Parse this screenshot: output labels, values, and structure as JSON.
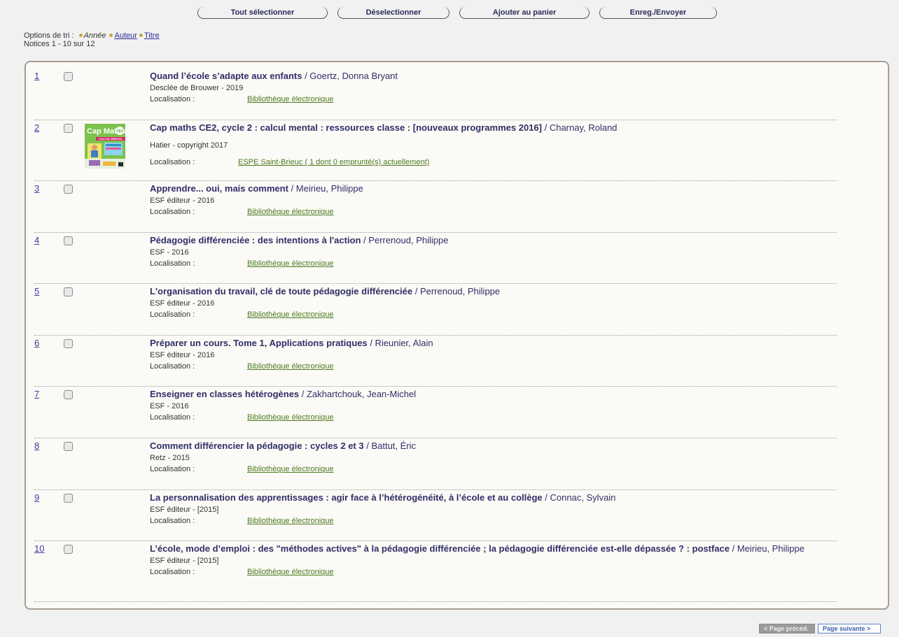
{
  "toolbar": {
    "select_all": "Tout sélectionner",
    "deselect": "Déselectionner",
    "add_cart": "Ajouter au panier",
    "save_send": "Enreg./Envoyer"
  },
  "sort": {
    "label": "Options de tri :",
    "year": "Année",
    "author": "Auteur",
    "title": "Titre",
    "count": "Notices 1 - 10 sur 12"
  },
  "records": [
    {
      "num": "1",
      "title": "Quand l’école s’adapte aux enfants",
      "author": " / Goertz, Donna Bryant",
      "pub": "Desclée de Brouwer - 2019",
      "loc_label": "Localisation :",
      "loc": "Bibliothèque électronique"
    },
    {
      "num": "2",
      "title": "Cap maths CE2, cycle 2 : calcul mental : ressources classe : [nouveaux programmes 2016]",
      "author": " / Charnay, Roland",
      "pub": "Hatier - copyright 2017",
      "loc_label": "Localisation :",
      "loc": "ESPE Saint-Brieuc ( 1 dont 0 emprunté(s) actuellement)",
      "cover": {
        "brand": "Cap Maths",
        "band": "CALCUL MENTAL",
        "level": "CE2"
      }
    },
    {
      "num": "3",
      "title": "Apprendre... oui, mais comment",
      "author": " / Meirieu, Philippe",
      "pub": "ESF éditeur - 2016",
      "loc_label": "Localisation :",
      "loc": "Bibliothèque électronique"
    },
    {
      "num": "4",
      "title": "Pédagogie différenciée : des intentions à l'action",
      "author": " / Perrenoud, Philippe",
      "pub": "ESF - 2016",
      "loc_label": "Localisation :",
      "loc": "Bibliothèque électronique"
    },
    {
      "num": "5",
      "title": "L'organisation du travail, clé de toute pédagogie différenciée",
      "author": " / Perrenoud, Philippe",
      "pub": "ESF éditeur - 2016",
      "loc_label": "Localisation :",
      "loc": "Bibliothèque électronique"
    },
    {
      "num": "6",
      "title": "Préparer un cours. Tome 1, Applications pratiques",
      "author": " / Rieunier, Alain",
      "pub": "ESF éditeur - 2016",
      "loc_label": "Localisation :",
      "loc": "Bibliothèque électronique"
    },
    {
      "num": "7",
      "title": "Enseigner en classes hétérogènes",
      "author": " / Zakhartchouk, Jean-Michel",
      "pub": "ESF - 2016",
      "loc_label": "Localisation :",
      "loc": "Bibliothèque électronique"
    },
    {
      "num": "8",
      "title": "Comment différencier la pédagogie : cycles 2 et 3",
      "author": " / Battut, Éric",
      "pub": "Retz - 2015",
      "loc_label": "Localisation :",
      "loc": "Bibliothèque électronique"
    },
    {
      "num": "9",
      "title": "La personnalisation des apprentissages : agir face à l’hétérogénéité, à l’école et au collège",
      "author": " / Connac, Sylvain",
      "pub": "ESF éditeur - [2015]",
      "loc_label": "Localisation :",
      "loc": "Bibliothèque électronique"
    },
    {
      "num": "10",
      "title": "L’école, mode d’emploi : des \"méthodes actives\" à la pédagogie différenciée ; la pédagogie différenciée est-elle dépassée ? : postface",
      "author": " / Meirieu, Philippe",
      "pub": "ESF éditeur - [2015]",
      "loc_label": "Localisation :",
      "loc": "Bibliothèque électronique"
    }
  ],
  "pager": {
    "prev": "< Page précéd.",
    "next": "Page suivante >"
  }
}
